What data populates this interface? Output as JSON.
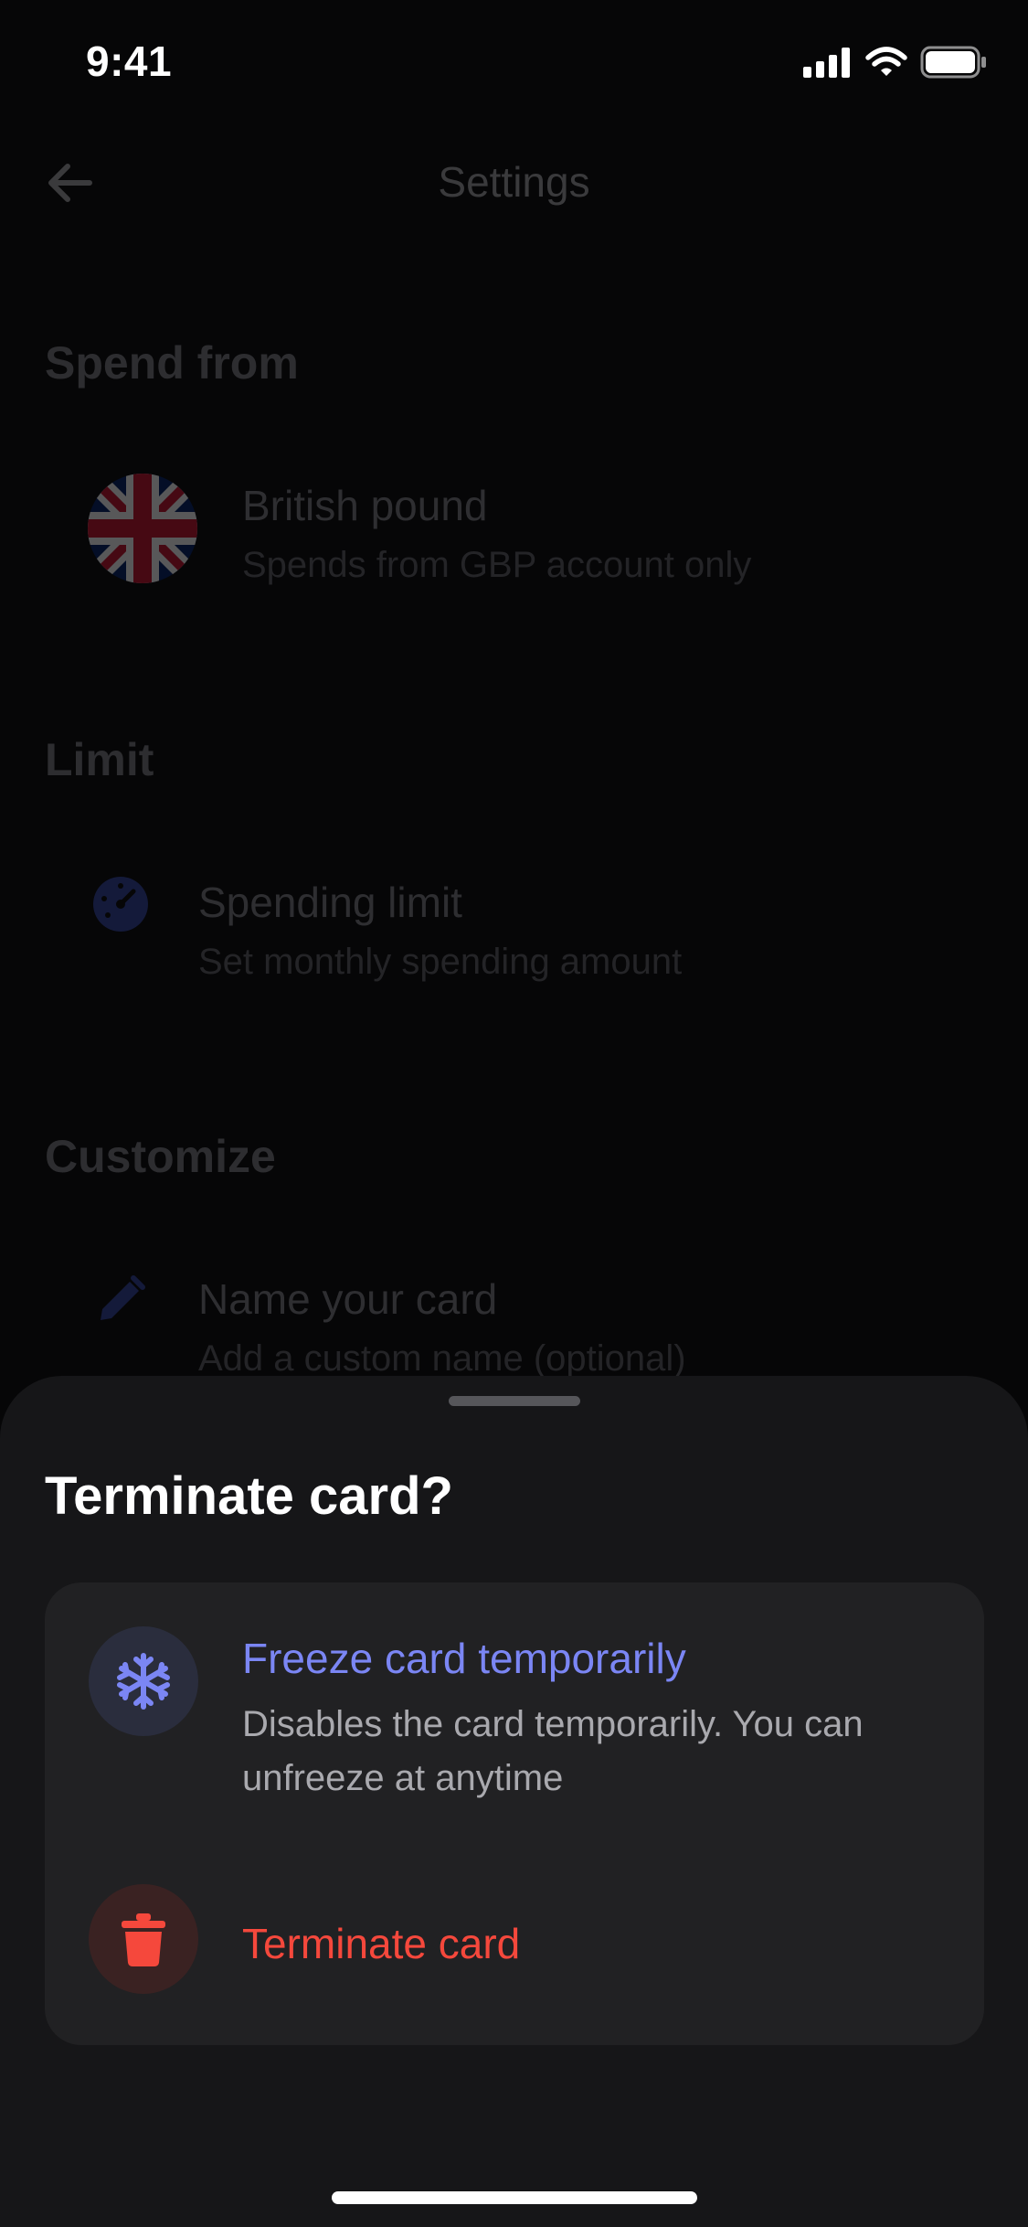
{
  "status_bar": {
    "time": "9:41"
  },
  "header": {
    "title": "Settings"
  },
  "sections": {
    "spend_from": {
      "title": "Spend from",
      "item": {
        "title": "British pound",
        "subtitle": "Spends from GBP account only"
      }
    },
    "limit": {
      "title": "Limit",
      "item": {
        "title": "Spending limit",
        "subtitle": "Set monthly spending amount"
      }
    },
    "customize": {
      "title": "Customize",
      "item": {
        "title": "Name your card",
        "subtitle": "Add a custom name (optional)"
      }
    }
  },
  "sheet": {
    "title": "Terminate card?",
    "options": [
      {
        "icon": "snowflake-icon",
        "title": "Freeze card temporarily",
        "description": "Disables the card temporarily. You can unfreeze at anytime",
        "color": "#7b86f4"
      },
      {
        "icon": "trash-icon",
        "title": "Terminate card",
        "color": "#f5483c"
      }
    ]
  }
}
